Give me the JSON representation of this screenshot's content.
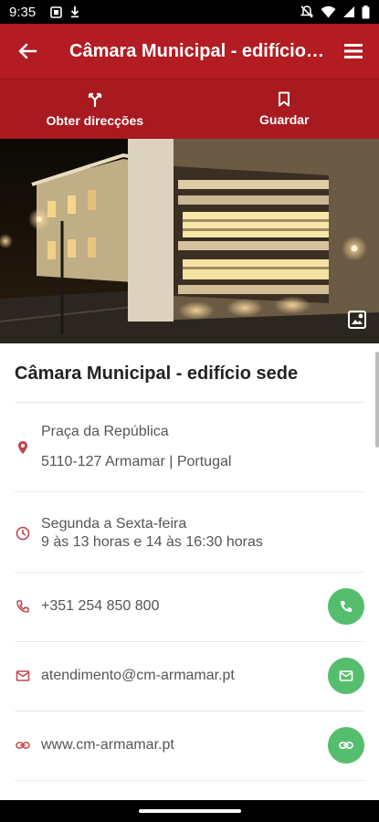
{
  "status_bar": {
    "time": "9:35"
  },
  "app_bar": {
    "title": "Câmara Municipal - edifício sede"
  },
  "actions": {
    "directions_label": "Obter direcções",
    "save_label": "Guardar"
  },
  "place": {
    "title": "Câmara Municipal - edifício sede",
    "address_line1": "Praça da República",
    "address_line2": "5110-127 Armamar | Portugal",
    "hours_line1": "Segunda a Sexta-feira",
    "hours_line2": "9 às 13 horas e 14 às 16:30 horas",
    "phone": "+351 254 850 800",
    "email": "atendimento@cm-armamar.pt",
    "website": "www.cm-armamar.pt"
  },
  "colors": {
    "primary": "#b21c22",
    "accent_green": "#55be6e",
    "icon_red": "#c0454a"
  }
}
